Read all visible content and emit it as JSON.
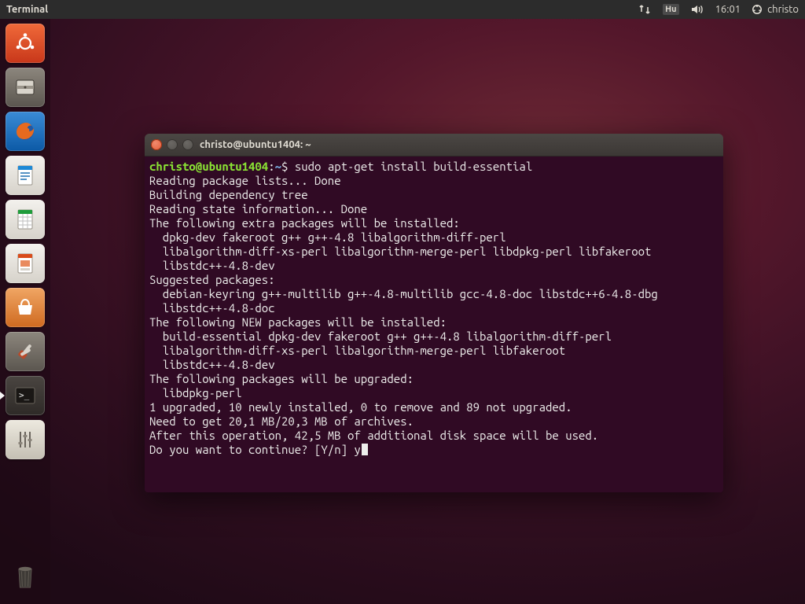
{
  "panel": {
    "app_name": "Terminal",
    "keyboard": "Hu",
    "clock": "16:01",
    "username": "christo"
  },
  "launcher": {
    "items": [
      {
        "name": "dash",
        "bg": "#dd4814"
      },
      {
        "name": "files",
        "bg": "#6f6a63"
      },
      {
        "name": "firefox",
        "bg": "#1074c8"
      },
      {
        "name": "writer",
        "bg": "#198fd8"
      },
      {
        "name": "calc",
        "bg": "#1f9c3b"
      },
      {
        "name": "impress",
        "bg": "#d94b1a"
      },
      {
        "name": "software",
        "bg": "#e47a2e"
      },
      {
        "name": "settings",
        "bg": "#6f6a63"
      },
      {
        "name": "terminal",
        "bg": "#3a3632"
      },
      {
        "name": "sound",
        "bg": "#bfb9ad"
      }
    ],
    "trash": {
      "name": "trash",
      "bg": "transparent"
    }
  },
  "window": {
    "title": "christo@ubuntu1404: ~"
  },
  "term": {
    "prompt_user": "christo@ubuntu1404",
    "prompt_path": "~",
    "prompt_symbol": "$",
    "command": "sudo apt-get install build-essential",
    "lines": [
      "Reading package lists... Done",
      "Building dependency tree",
      "Reading state information... Done",
      "The following extra packages will be installed:",
      "  dpkg-dev fakeroot g++ g++-4.8 libalgorithm-diff-perl",
      "  libalgorithm-diff-xs-perl libalgorithm-merge-perl libdpkg-perl libfakeroot",
      "  libstdc++-4.8-dev",
      "Suggested packages:",
      "  debian-keyring g++-multilib g++-4.8-multilib gcc-4.8-doc libstdc++6-4.8-dbg",
      "  libstdc++-4.8-doc",
      "The following NEW packages will be installed:",
      "  build-essential dpkg-dev fakeroot g++ g++-4.8 libalgorithm-diff-perl",
      "  libalgorithm-diff-xs-perl libalgorithm-merge-perl libfakeroot",
      "  libstdc++-4.8-dev",
      "The following packages will be upgraded:",
      "  libdpkg-perl",
      "1 upgraded, 10 newly installed, 0 to remove and 89 not upgraded.",
      "Need to get 20,1 MB/20,3 MB of archives.",
      "After this operation, 42,5 MB of additional disk space will be used.",
      "Do you want to continue? [Y/n] y"
    ]
  }
}
